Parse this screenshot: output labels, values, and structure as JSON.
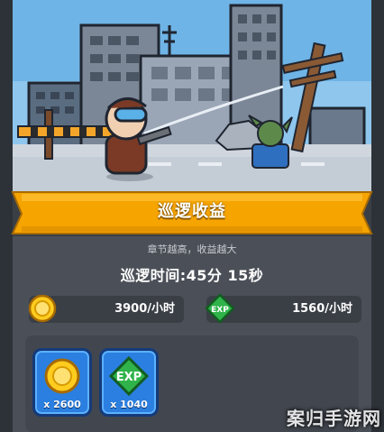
{
  "banner": {
    "title": "巡逻收益"
  },
  "panel": {
    "subtitle": "章节越高，收益越大",
    "patrol_time": "巡逻时间:45分 15秒"
  },
  "rates": {
    "gold": {
      "icon": "gold-coin-icon",
      "value": "3900/小时"
    },
    "exp": {
      "icon": "exp-gem-icon",
      "icon_text": "EXP",
      "value": "1560/小时"
    }
  },
  "rewards": [
    {
      "icon": "gold-coin-icon",
      "count": "x 2600"
    },
    {
      "icon": "exp-gem-icon",
      "icon_text": "EXP",
      "count": "x 1040"
    }
  ],
  "watermark": "案归手游网",
  "colors": {
    "sky": "#6fb4e6",
    "banner_orange": "#f5a400",
    "panel_gray": "#4b5058",
    "card_blue": "#2a7fe0",
    "exp_green": "#2fb34a",
    "coin_gold": "#ffcc1f"
  }
}
